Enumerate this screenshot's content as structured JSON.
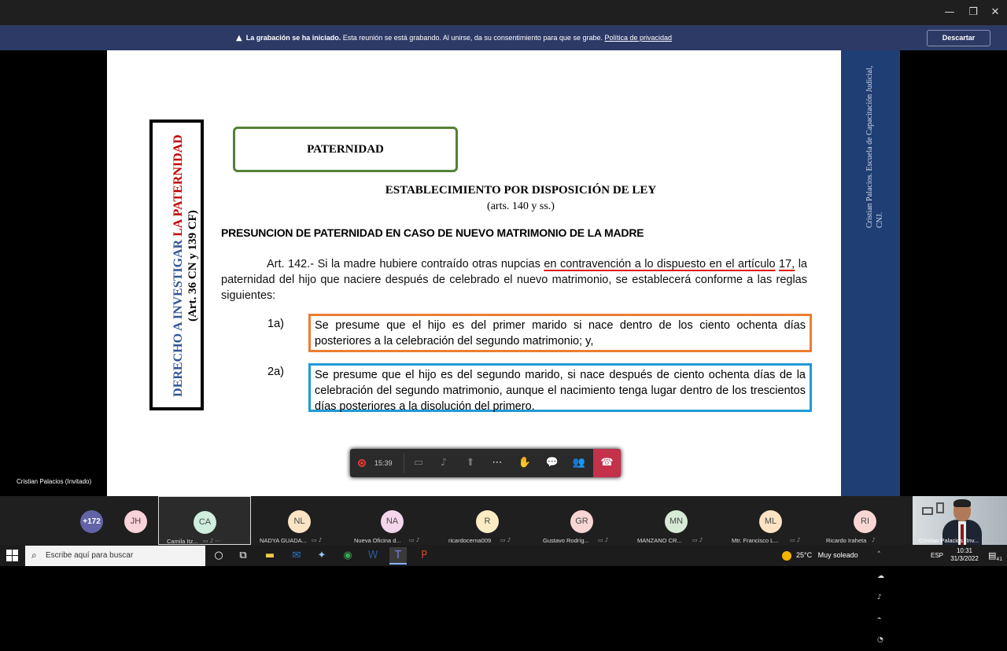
{
  "window": {
    "minimize": "—",
    "restore": "❐",
    "close": "✕"
  },
  "banner": {
    "bold": "La grabación se ha iniciado.",
    "text": " Esta reunión se está grabando. Al unirse, da su consentimiento para que se grabe. ",
    "link": "Política de privacidad",
    "discard_label": "Descartar"
  },
  "slide": {
    "vertical_part1": "DERECHO A INVESTIGAR ",
    "vertical_part2": "LA PATERNIDAD",
    "vertical_sub": "(Art. 36 CN y 139 CF)",
    "box_title": "PATERNIDAD",
    "est_title": "ESTABLECIMIENTO POR DISPOSICIÓN DE LEY",
    "est_sub": "(arts. 140 y ss.)",
    "heading": "PRESUNCION DE PATERNIDAD EN CASO DE NUEVO MATRIMONIO DE LA MADRE",
    "art_part1": "Art. 142.- Si la madre hubiere contraído otras nupcias ",
    "art_underlined1": "en contravención a lo dispuesto en el artículo",
    "art_underlined2": "17,",
    "art_part2": " la paternidad del hijo que naciere después de celebrado el nuevo matrimonio, se establecerá conforme a las reglas siguientes:",
    "item1_label": "1a)",
    "item1_text": "Se presume que el hijo es del primer marido si nace dentro de los ciento ochenta días posteriores a la celebración del segundo matrimonio; y,",
    "item2_label": "2a)",
    "item2_text": "Se presume que el hijo es del segundo marido, si nace después de ciento ochenta días de la celebración del segundo matrimonio, aunque el nacimiento tenga lugar dentro de los trescientos días posteriores a la disolución del primero.",
    "side_text1": "Cristian Palacios. Escuela de Capacitación Judicial,",
    "side_text2": "CNJ."
  },
  "presenter_label": "Cristian Palacios (Invitado)",
  "controls": {
    "recording_time": "15:39"
  },
  "participants": {
    "more": "+172",
    "jh": "JH",
    "tiles": [
      {
        "initials": "CA",
        "name": "Camila Itz...",
        "color": "#cfeedd"
      },
      {
        "initials": "NL",
        "name": "NADYA GUADA...",
        "color": "#fbe3c4"
      },
      {
        "initials": "NA",
        "name": "Nueva Oficina d...",
        "color": "#f3d6ec"
      },
      {
        "initials": "R",
        "name": "ricardocerna009",
        "color": "#fbecc4"
      },
      {
        "initials": "GR",
        "name": "Gustavo Rodríg...",
        "color": "#f8d6d3"
      },
      {
        "initials": "MN",
        "name": "MANZANO CR...",
        "color": "#d7ead6"
      },
      {
        "initials": "ML",
        "name": "Mtr. Francisco L...",
        "color": "#fbe3c4"
      },
      {
        "initials": "RI",
        "name": "Ricardo Iraheta",
        "color": "#f8d6d3"
      }
    ],
    "camera_name": "Cristian Palacios (Inv..."
  },
  "taskbar": {
    "search_placeholder": "Escribe aquí para buscar",
    "temperature": "25°C",
    "weather": "Muy soleado",
    "lang": "ESP",
    "time": "10:31",
    "date": "31/3/2022",
    "notif_count": "41"
  }
}
